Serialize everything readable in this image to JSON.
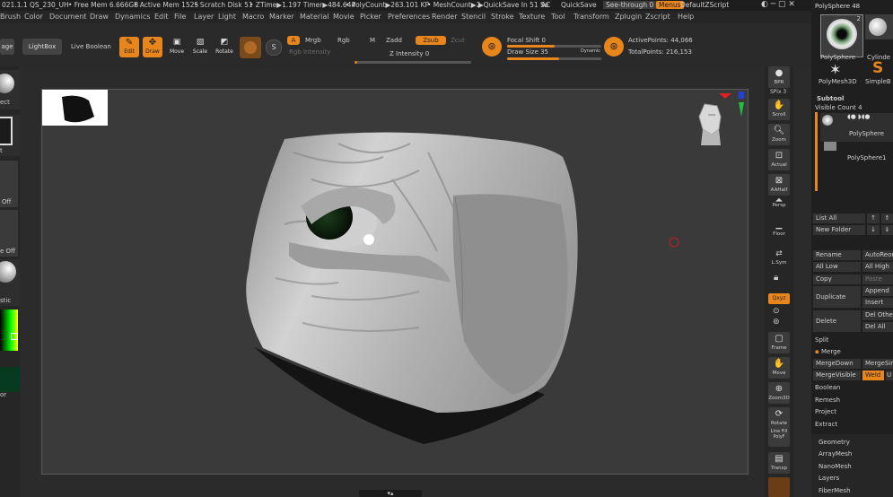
{
  "titlebar": {
    "version": "021.1.1 QS_230_UH",
    "free_mem": "• Free Mem 6.666GB",
    "active_mem": "• Active Mem 1525",
    "scratch": "• Scratch Disk 51",
    "ztime": "• ZTime▶1.197 Timer▶484.644",
    "polycount": "• PolyCount▶263.101 KP",
    "meshcount": "• MeshCount▶2",
    "quicksave_in": "▶QuickSave In 51 Se",
    "ac": "AC",
    "quicksave": "QuickSave",
    "see_through": "See-through 0",
    "menus": "Menus",
    "default_script": "DefaultZScript"
  },
  "menubar": [
    "Brush",
    "Color",
    "Document",
    "Draw",
    "Dynamics",
    "Edit",
    "File",
    "Layer",
    "Light",
    "Macro",
    "Marker",
    "Material",
    "Movie",
    "Picker",
    "Preferences",
    "Render",
    "Stencil",
    "Stroke",
    "Texture",
    "Tool",
    "Transform",
    "Zplugin",
    "Zscript",
    "Help"
  ],
  "toolbar": {
    "home_page": "age",
    "lightbox": "LightBox",
    "live_boolean": "Live Boolean",
    "edit": "Edit",
    "draw": "Draw",
    "move": "Move",
    "scale": "Scale",
    "rotate": "Rotate",
    "a": "A",
    "mrgb": "Mrgb",
    "rgb": "Rgb",
    "m": "M",
    "zadd": "Zadd",
    "zsub": "Zsub",
    "zcut": "Zcut",
    "rgb_intensity": "Rgb Intensity",
    "z_intensity": "Z Intensity 0",
    "focal_shift": "Focal Shift 0",
    "draw_size": "Draw Size 35",
    "dynamic": "Dynamic",
    "active_points": "ActivePoints: 44,066",
    "total_points": "TotalPoints: 216,153",
    "focal_shift_level": 0.5,
    "draw_size_level": 0.55,
    "z_intensity_level": 0.02
  },
  "left_shelf": {
    "ect": "ect",
    "t": "t",
    "off1": "Off",
    "off2": "e Off",
    "stic": "stic",
    "or": "or"
  },
  "right_shelf": [
    {
      "name": "bpr",
      "label": "BPR"
    },
    {
      "name": "spix",
      "label": "SPix 3"
    },
    {
      "name": "scroll",
      "label": "Scroll"
    },
    {
      "name": "zoom",
      "label": "Zoom"
    },
    {
      "name": "actual",
      "label": "Actual"
    },
    {
      "name": "aahalf",
      "label": "AAHalf"
    },
    {
      "name": "persp",
      "label": "Persp"
    },
    {
      "name": "floor",
      "label": "Floor"
    },
    {
      "name": "lsym",
      "label": "L.Sym"
    },
    {
      "name": "lock",
      "label": ""
    },
    {
      "name": "xyz",
      "label": "Qxyz"
    },
    {
      "name": "frame",
      "label": "Frame"
    },
    {
      "name": "move",
      "label": "Move"
    },
    {
      "name": "zoom3d",
      "label": "Zoom3D"
    },
    {
      "name": "rotate",
      "label": "Rotate"
    },
    {
      "name": "linefill",
      "label": "Line Fill PolyF"
    },
    {
      "name": "transp",
      "label": "Transp"
    }
  ],
  "right_panel": {
    "polysphere_header": "PolySphere  48",
    "thumb_num": "2",
    "thumb1": "PolySphere",
    "thumb2": "Cylinde",
    "thumb3": "PolyMesh3D",
    "thumb4": "SimpleB",
    "subtool": "Subtool",
    "visible_count": "Visible Count 4",
    "st1": "PolySphere",
    "st2": "PolySphere1",
    "list_all": "List All",
    "new_folder": "New Folder",
    "rename": "Rename",
    "autoreorder": "AutoReord",
    "all_low": "All Low",
    "all_high": "All High",
    "copy": "Copy",
    "paste": "Paste",
    "duplicate": "Duplicate",
    "append": "Append",
    "insert": "Insert",
    "delete": "Delete",
    "del_other": "Del Other",
    "del_all": "Del All",
    "split": "Split",
    "merge": "Merge",
    "mergedown": "MergeDown",
    "mergesim": "MergeSim",
    "mergevisible": "MergeVisible",
    "weld": "Weld",
    "u": "U",
    "boolean": "Boolean",
    "remesh": "Remesh",
    "project": "Project",
    "extract": "Extract",
    "geometry": "Geometry",
    "arraymesh": "ArrayMesh",
    "nanomesh": "NanoMesh",
    "layers": "Layers",
    "fibermesh": "FiberMesh"
  },
  "colors": {
    "accent": "#e8861c",
    "bg": "#2b2b2b",
    "canvas": "#3a3a3a"
  }
}
